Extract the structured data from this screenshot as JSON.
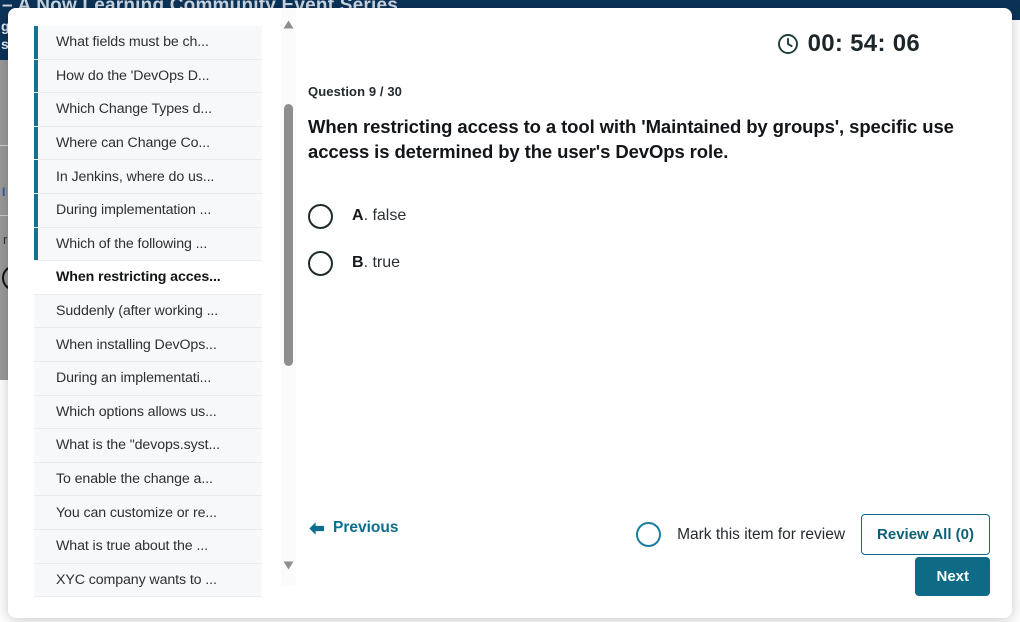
{
  "background": {
    "banner_title": "t – A Now Learning Community Event Series",
    "side_fragment_line1": "g",
    "side_fragment_line2": "s",
    "fragment_blue": "I",
    "fragment_gray": "r"
  },
  "sidebar": {
    "questions": [
      {
        "label": "What fields must be ch...",
        "answered": true,
        "active": false
      },
      {
        "label": "How do the 'DevOps D...",
        "answered": true,
        "active": false
      },
      {
        "label": "Which Change Types d...",
        "answered": true,
        "active": false
      },
      {
        "label": "Where can Change Co...",
        "answered": true,
        "active": false
      },
      {
        "label": "In Jenkins, where do us...",
        "answered": true,
        "active": false
      },
      {
        "label": "During implementation ...",
        "answered": true,
        "active": false
      },
      {
        "label": "Which of the following ...",
        "answered": true,
        "active": false
      },
      {
        "label": "When restricting acces...",
        "answered": false,
        "active": true
      },
      {
        "label": "Suddenly (after working ...",
        "answered": false,
        "active": false
      },
      {
        "label": "When installing DevOps...",
        "answered": false,
        "active": false
      },
      {
        "label": "During an implementati...",
        "answered": false,
        "active": false
      },
      {
        "label": "Which options allows us...",
        "answered": false,
        "active": false
      },
      {
        "label": "What is the \"devops.syst...",
        "answered": false,
        "active": false
      },
      {
        "label": "To enable the change a...",
        "answered": false,
        "active": false
      },
      {
        "label": "You can customize or re...",
        "answered": false,
        "active": false
      },
      {
        "label": "What is true about the ...",
        "answered": false,
        "active": false
      },
      {
        "label": "XYC company wants to ...",
        "answered": false,
        "active": false
      }
    ],
    "scrollbar": {
      "up_arrow_icon": "chevron-up-icon",
      "down_arrow_icon": "chevron-down-icon"
    }
  },
  "main": {
    "timer": {
      "icon": "clock-icon",
      "value": "00: 54: 06"
    },
    "question_counter": "Question 9 / 30",
    "question_text": "When restricting access to a tool with 'Maintained by groups', specific use access is determined by the user's DevOps role.",
    "options": [
      {
        "letter": "A",
        "text": "false",
        "selected": false
      },
      {
        "letter": "B",
        "text": "true",
        "selected": false
      }
    ]
  },
  "footer": {
    "previous_label": "Previous",
    "previous_icon": "arrow-left-icon",
    "mark_review_label": "Mark this item for review",
    "mark_review_checked": false,
    "review_all_label": "Review All (0)",
    "next_label": "Next"
  },
  "colors": {
    "accent_teal": "#0e6a85",
    "answered_bar": "#15728c",
    "banner_navy": "#0b3359",
    "text_dark": "#131619"
  }
}
